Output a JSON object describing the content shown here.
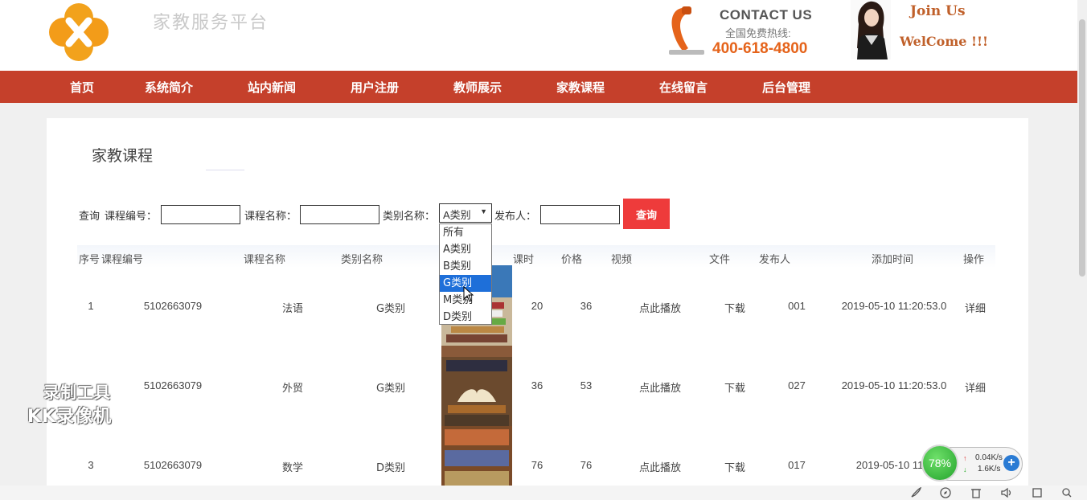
{
  "header": {
    "site_title": "家教服务平台",
    "contact_label": "CONTACT US",
    "hotline_label": "全国免费热线:",
    "phone": "400-618-4800",
    "join_us": "Join Us",
    "welcome": "WelCome !!!",
    "accent_color": "#e5631a"
  },
  "nav": {
    "color": "#c5402b",
    "items": [
      {
        "label": "首页"
      },
      {
        "label": "系统简介"
      },
      {
        "label": "站内新闻"
      },
      {
        "label": "用户注册"
      },
      {
        "label": "教师展示"
      },
      {
        "label": "家教课程"
      },
      {
        "label": "在线留言"
      },
      {
        "label": "后台管理"
      }
    ]
  },
  "main": {
    "section_title": "家教课程",
    "search": {
      "query_label": "查询",
      "course_no_label": "课程编号：",
      "course_no_value": "",
      "course_name_label": "课程名称：",
      "course_name_value": "",
      "category_label": "类别名称：",
      "category_selected": "A类别",
      "publisher_label": "发布人：",
      "publisher_value": "",
      "button_label": "查询"
    },
    "dropdown": {
      "options": [
        "所有",
        "A类别",
        "B类别",
        "G类别",
        "M类别",
        "D类别"
      ],
      "highlighted": "G类别"
    },
    "table": {
      "headers": [
        "序号",
        "课程编号",
        "课程名称",
        "类别名称",
        "课时",
        "价格",
        "视频",
        "文件",
        "发布人",
        "添加时间",
        "操作"
      ],
      "rows": [
        {
          "index": "1",
          "course_no": "5102663079",
          "name": "法语",
          "category": "G类别",
          "hours": "20",
          "price": "36",
          "video": "点此播放",
          "file": "下载",
          "publisher": "001",
          "time": "2019-05-10 11:20:53.0",
          "action": "详细"
        },
        {
          "index": "",
          "course_no": "5102663079",
          "name": "外贸",
          "category": "G类别",
          "hours": "36",
          "price": "53",
          "video": "点此播放",
          "file": "下载",
          "publisher": "027",
          "time": "2019-05-10 11:20:53.0",
          "action": "详细"
        },
        {
          "index": "3",
          "course_no": "5102663079",
          "name": "数学",
          "category": "D类别",
          "hours": "76",
          "price": "76",
          "video": "点此播放",
          "file": "下载",
          "publisher": "017",
          "time": "2019-05-10 11:2",
          "action": "详细"
        }
      ]
    }
  },
  "watermark": {
    "line1": "录制工具",
    "line2": "KK录像机"
  },
  "net_widget": {
    "percent": "78%",
    "upload": "0.04K/s",
    "download": "1.6K/s",
    "gauge_color": "#23a32c"
  },
  "toolbar_icons": [
    "rocket-icon",
    "compass-icon",
    "trash-icon",
    "volume-icon",
    "window-icon",
    "search-icon"
  ]
}
